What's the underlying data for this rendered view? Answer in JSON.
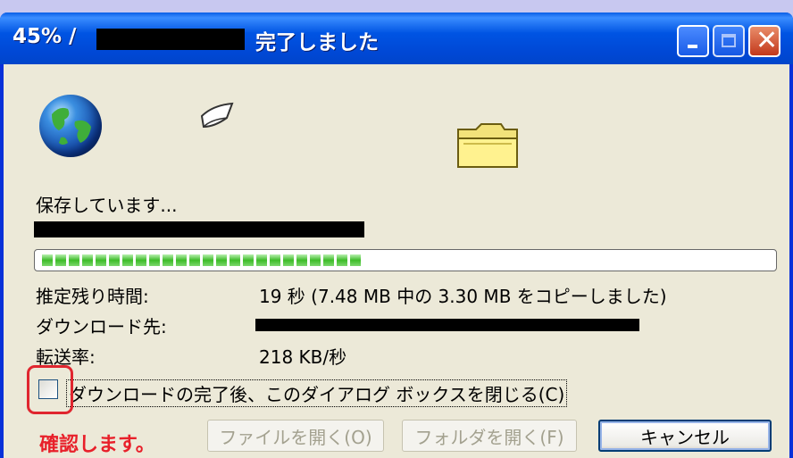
{
  "window": {
    "title_prefix": "45% / ",
    "title_suffix": "完了しました"
  },
  "status": {
    "saving_label": "保存しています..."
  },
  "progress": {
    "percent": 45
  },
  "details": {
    "remaining_label": "推定残り時間:",
    "remaining_value": "19 秒 (7.48 MB 中の 3.30 MB をコピーしました)",
    "destination_label": "ダウンロード先:",
    "rate_label": "転送率:",
    "rate_value": "218 KB/秒"
  },
  "options": {
    "close_on_complete_label": "ダウンロードの完了後、このダイアログ ボックスを閉じる(C)",
    "close_on_complete_checked": false
  },
  "annotation": {
    "note": "確認します。",
    "highlight_color": "#e0262f"
  },
  "buttons": {
    "open_file": "ファイルを開く(O)",
    "open_folder": "フォルダを開く(F)",
    "cancel": "キャンセル"
  },
  "icons": {
    "globe": "globe-icon",
    "paper": "flying-document-icon",
    "folder": "folder-icon"
  }
}
